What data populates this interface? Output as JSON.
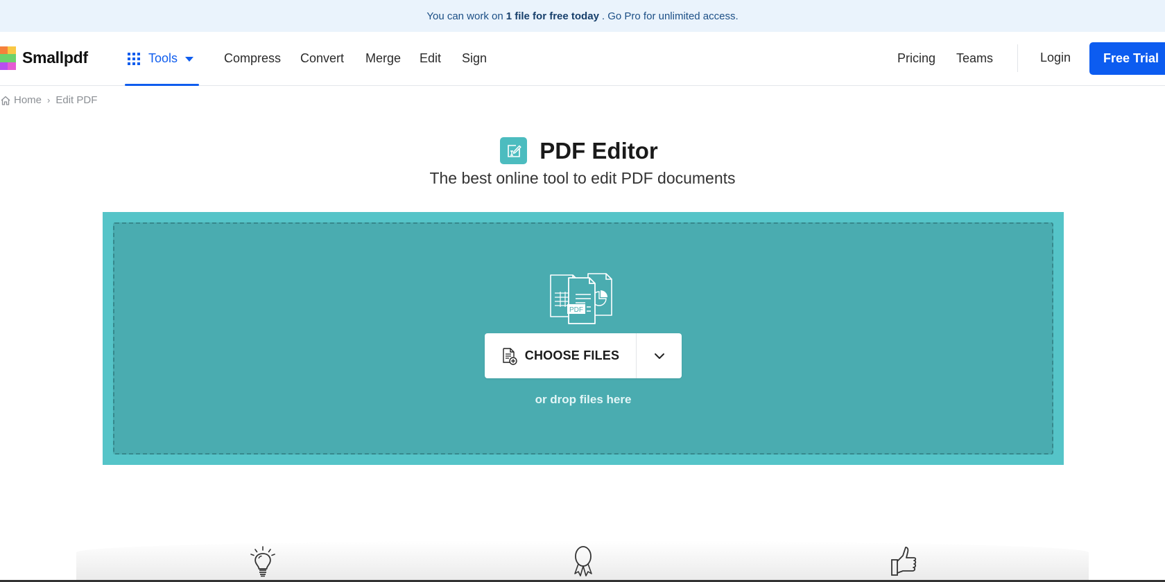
{
  "banner": {
    "text_before": "You can work on",
    "text_bold": "1 file for free today",
    "text_after": ". Go Pro for unlimited access."
  },
  "header": {
    "brand": "Smallpdf",
    "tools_label": "Tools",
    "nav": [
      "Compress",
      "Convert",
      "Merge",
      "Edit",
      "Sign"
    ],
    "right_links": [
      "Pricing",
      "Teams"
    ],
    "login_label": "Login",
    "cta_label": "Free Trial"
  },
  "breadcrumb": {
    "home": "Home",
    "separator": "›",
    "current": "Edit PDF"
  },
  "page": {
    "title": "PDF Editor",
    "subtitle": "The best online tool to edit PDF documents"
  },
  "dropzone": {
    "choose_label": "CHOOSE FILES",
    "hint": "or drop files here",
    "illustration_badge": "PDF"
  },
  "features": {
    "icons": [
      "lightbulb-icon",
      "award-ribbon-icon",
      "thumbs-up-icon"
    ]
  },
  "colors": {
    "brand_blue": "#0c5cf0",
    "teal_outer": "#55c4c8",
    "teal_inner": "#4aacb0",
    "banner_bg": "#eaf3fc"
  }
}
